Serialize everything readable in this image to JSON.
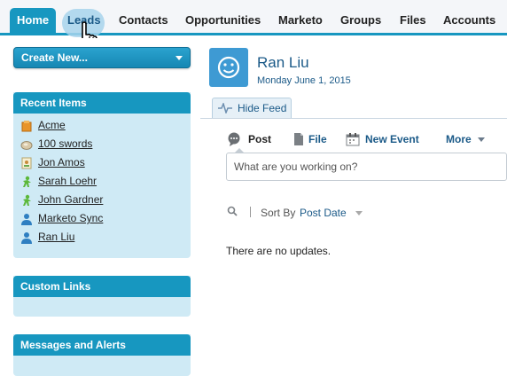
{
  "tabs": [
    {
      "label": "Home"
    },
    {
      "label": "Leads"
    },
    {
      "label": "Contacts"
    },
    {
      "label": "Opportunities"
    },
    {
      "label": "Marketo"
    },
    {
      "label": "Groups"
    },
    {
      "label": "Files"
    },
    {
      "label": "Accounts"
    }
  ],
  "sidebar": {
    "create_new_label": "Create New...",
    "recent_items_title": "Recent Items",
    "recent_items": [
      {
        "label": "Acme",
        "icon": "account-icon"
      },
      {
        "label": "100 swords",
        "icon": "opportunity-icon"
      },
      {
        "label": "Jon Amos",
        "icon": "contact-card-icon"
      },
      {
        "label": "Sarah Loehr",
        "icon": "lead-icon"
      },
      {
        "label": "John Gardner",
        "icon": "lead-icon"
      },
      {
        "label": "Marketo Sync",
        "icon": "user-icon"
      },
      {
        "label": "Ran Liu",
        "icon": "user-icon"
      }
    ],
    "custom_links_title": "Custom Links",
    "messages_title": "Messages and Alerts"
  },
  "profile": {
    "name": "Ran Liu",
    "date": "Monday June 1, 2015"
  },
  "feed": {
    "hide_feed_label": "Hide Feed",
    "publisher_tabs": {
      "post": "Post",
      "file": "File",
      "new_event": "New Event",
      "more": "More"
    },
    "post_placeholder": "What are you working on?",
    "sort_by_label": "Sort By",
    "sort_value": "Post Date",
    "empty_message": "There are no updates."
  },
  "colors": {
    "accent": "#1797c0",
    "link": "#1b5a88",
    "panel_bg": "#cfeaf5"
  }
}
